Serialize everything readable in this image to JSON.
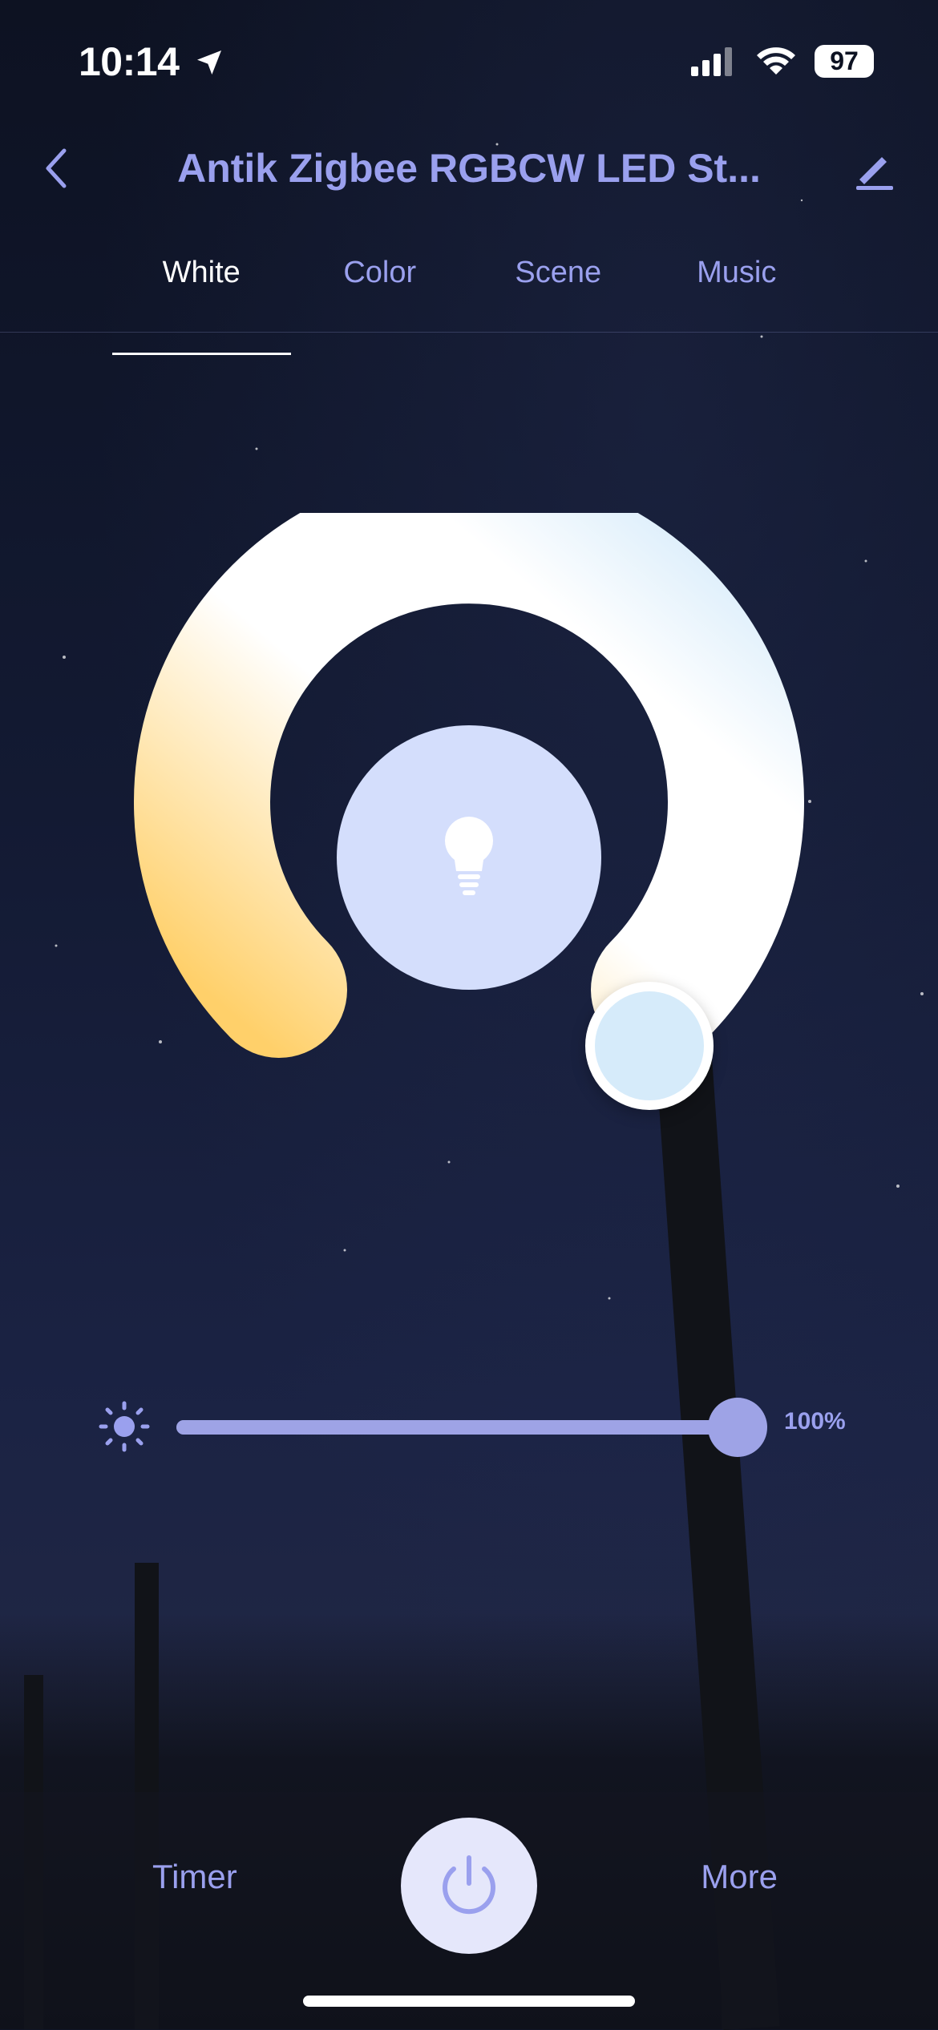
{
  "status_bar": {
    "time": "10:14",
    "battery": "97",
    "icons": [
      "location-arrow-icon",
      "cellular-signal-icon",
      "wifi-icon",
      "battery-icon"
    ]
  },
  "header": {
    "title": "Antik Zigbee RGBCW LED St...",
    "back_icon": "chevron-left-icon",
    "edit_icon": "pencil-icon"
  },
  "tabs": [
    {
      "label": "White",
      "active": true
    },
    {
      "label": "Color",
      "active": false
    },
    {
      "label": "Scene",
      "active": false
    },
    {
      "label": "Music",
      "active": false
    }
  ],
  "color_temperature": {
    "center_icon": "light-bulb-icon",
    "warm_color": "#ffd06a",
    "neutral_color": "#ffffff",
    "cool_color": "#d6ebfa",
    "knob_position": 0.9
  },
  "brightness": {
    "icon": "sun-icon",
    "value": 1.0,
    "label": "100%"
  },
  "bottom_bar": {
    "timer_label": "Timer",
    "more_label": "More",
    "power_icon": "power-icon"
  },
  "colors": {
    "accent": "#9aa0ee",
    "slider_fill": "#9ea3e6",
    "bulb_circle": "#d4defc",
    "power_button": "#e5e7fb"
  }
}
